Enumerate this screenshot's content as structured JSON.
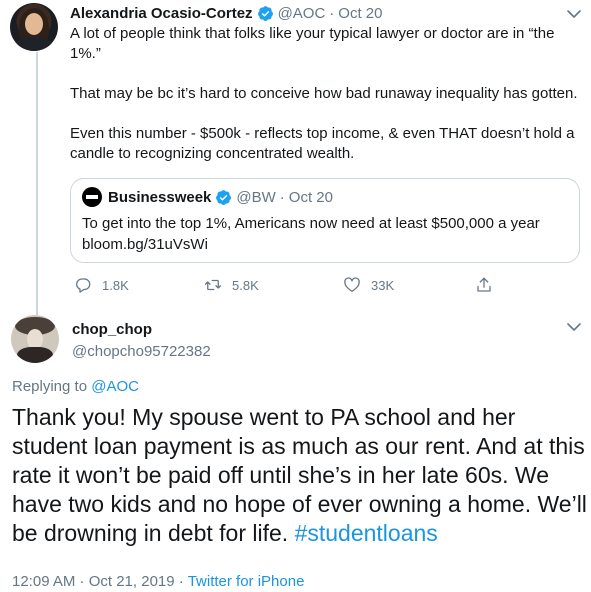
{
  "parent_tweet": {
    "name": "Alexandria Ocasio-Cortez",
    "handle": "@AOC",
    "separator": "·",
    "date": "Oct 20",
    "paragraphs": [
      "A lot of people think that folks like your typical lawyer or doctor are in “the 1%.”",
      "That may be bc it’s hard to conceive how bad runaway inequality has gotten.",
      "Even this number - $500k - reflects top income, & even THAT doesn’t hold a candle to recognizing concentrated wealth."
    ],
    "quote": {
      "name": "Businessweek",
      "handle": "@BW",
      "separator": "·",
      "date": "Oct 20",
      "text_line1": "To get into the top 1%, Americans now need at least $500,000 a year",
      "text_line2": "bloom.bg/31uVsWi"
    },
    "actions": {
      "replies": "1.8K",
      "retweets": "5.8K",
      "likes": "33K"
    }
  },
  "reply_tweet": {
    "name": "chop_chop",
    "handle": "@chopcho95722382",
    "replying_to_label": "Replying to",
    "replying_to_handle": "@AOC",
    "text": "Thank you! My spouse went to PA school and her student loan payment is as much as our rent. And at this rate it won’t be paid off until she’s in her late 60s. We have two kids and no hope of ever owning a home. We’ll be drowning in debt for life.",
    "hashtag": "#studentloans",
    "timestamp": "12:09 AM · Oct 21, 2019",
    "separator": "·",
    "source": "Twitter for iPhone"
  },
  "icons": {
    "verified": "verified-badge-icon",
    "caret": "chevron-down-icon",
    "reply": "reply-icon",
    "retweet": "retweet-icon",
    "like": "heart-icon",
    "share": "share-icon"
  },
  "colors": {
    "text": "#14171a",
    "muted": "#657786",
    "link": "#1b95e0",
    "verified": "#1da1f2",
    "border": "#ccd6dd"
  }
}
